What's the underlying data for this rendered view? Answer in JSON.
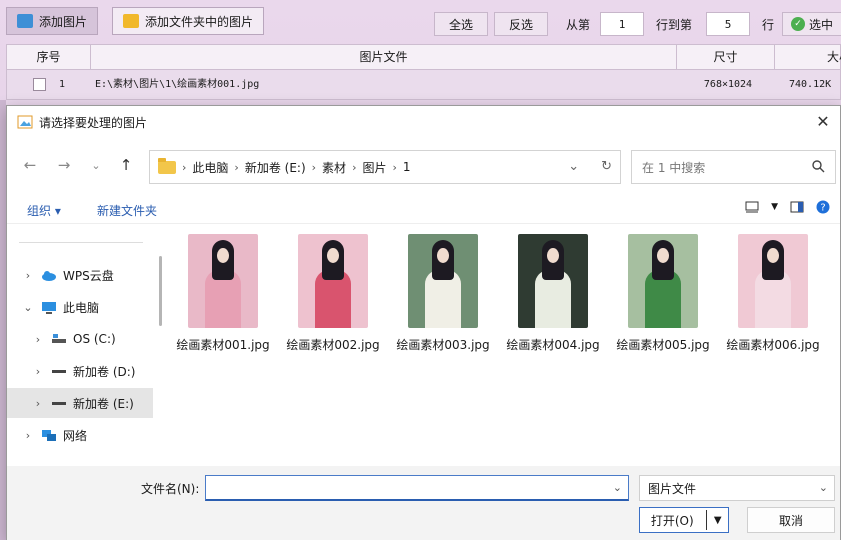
{
  "app": {
    "toolbar": {
      "add_images_label": "添加图片",
      "add_folder_label": "添加文件夹中的图片",
      "select_all_label": "全选",
      "invert_label": "反选",
      "from_label": "从第",
      "from_value": "1",
      "to_label": "行到第",
      "to_value": "5",
      "row_label": "行",
      "select_label": "选中"
    },
    "grid": {
      "headers": [
        "序号",
        "图片文件",
        "尺寸",
        "大小"
      ],
      "rows": [
        {
          "index": "1",
          "file": "E:\\素材\\图片\\1\\绘画素材001.jpg",
          "dimensions": "768×1024",
          "size": "740.12K"
        }
      ]
    }
  },
  "dialog": {
    "title": "请选择要处理的图片",
    "breadcrumb": [
      "此电脑",
      "新加卷 (E:)",
      "素材",
      "图片",
      "1"
    ],
    "search_placeholder": "在 1 中搜索",
    "organize_label": "组织 ▾",
    "new_folder_label": "新建文件夹",
    "nav_items": [
      {
        "label": "WPS云盘",
        "icon": "cloud-icon"
      },
      {
        "label": "此电脑",
        "icon": "computer-icon"
      },
      {
        "label": "OS (C:)",
        "icon": "drive-icon"
      },
      {
        "label": "新加卷 (D:)",
        "icon": "drive-icon"
      },
      {
        "label": "新加卷 (E:)",
        "icon": "drive-icon"
      },
      {
        "label": "网络",
        "icon": "network-icon"
      }
    ],
    "files": [
      {
        "name": "绘画素材001.jpg",
        "bg": "#e9b9c8",
        "robe": "#e7a0b4"
      },
      {
        "name": "绘画素材002.jpg",
        "bg": "#eec2cf",
        "robe": "#d9546e"
      },
      {
        "name": "绘画素材003.jpg",
        "bg": "#6f8f73",
        "robe": "#f0efe6"
      },
      {
        "name": "绘画素材004.jpg",
        "bg": "#2f3b32",
        "robe": "#e8ece1"
      },
      {
        "name": "绘画素材005.jpg",
        "bg": "#a6bfa0",
        "robe": "#3f8a47"
      },
      {
        "name": "绘画素材006.jpg",
        "bg": "#f0c9d4",
        "robe": "#f3dbe3"
      }
    ],
    "filename_label": "文件名(N):",
    "filename_value": "",
    "filetype_value": "图片文件",
    "open_label": "打开(O)",
    "cancel_label": "取消"
  }
}
